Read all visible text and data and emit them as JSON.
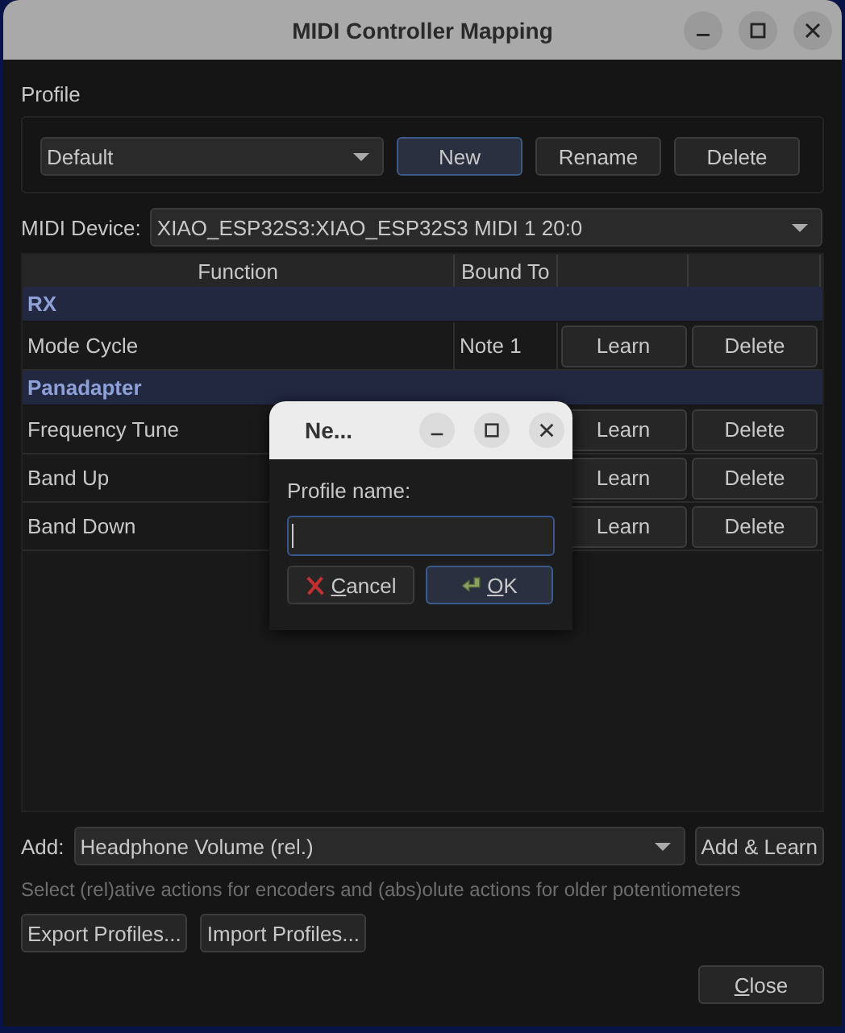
{
  "window": {
    "title": "MIDI Controller Mapping"
  },
  "profile": {
    "label": "Profile",
    "value": "Default",
    "buttons": [
      {
        "label": "New",
        "focused": true
      },
      {
        "label": "Rename",
        "focused": false
      },
      {
        "label": "Delete",
        "focused": false
      }
    ]
  },
  "midi_device": {
    "label": "MIDI Device:",
    "value": "XIAO_ESP32S3:XIAO_ESP32S3 MIDI 1 20:0"
  },
  "table": {
    "columns": [
      "Function",
      "Bound To"
    ],
    "rows": [
      {
        "kind": "group",
        "label": "RX"
      },
      {
        "kind": "mapping",
        "function": "Mode Cycle",
        "bound_to": "Note 1",
        "learn": "Learn",
        "delete": "Delete"
      },
      {
        "kind": "group",
        "label": "Panadapter"
      },
      {
        "kind": "mapping",
        "function": "Frequency Tune",
        "learn": "Learn",
        "delete": "Delete"
      },
      {
        "kind": "mapping",
        "function": "Band Up",
        "learn": "Learn",
        "delete": "Delete"
      },
      {
        "kind": "mapping",
        "function": "Band Down",
        "learn": "Learn",
        "delete": "Delete"
      }
    ]
  },
  "add": {
    "label": "Add:",
    "value": "Headphone Volume (rel.)",
    "button": "Add & Learn"
  },
  "hint": "Select (rel)ative actions for encoders and (abs)olute actions for older potentiometers",
  "footer_buttons": [
    "Export Profiles...",
    "Import Profiles..."
  ],
  "close": "Close",
  "dialog": {
    "title": "Ne...",
    "label": "Profile name:",
    "buttons": [
      {
        "kind": "cancel",
        "label": "Cancel",
        "focused": false
      },
      {
        "kind": "ok",
        "label": "OK",
        "focused": true
      }
    ]
  }
}
